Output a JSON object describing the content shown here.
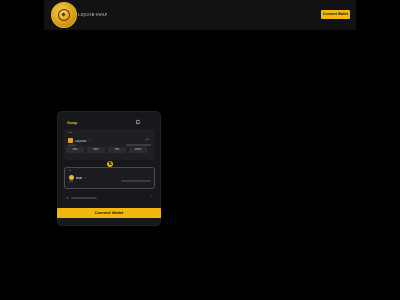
{
  "header": {
    "brand": "LIQUOR-SWAP",
    "connect_label": "Connect Wallet"
  },
  "card": {
    "title": "Swap",
    "from": {
      "label": "From",
      "token": "LIQUOR",
      "token_sub": "LIQUOR",
      "balance_label": "Bal"
    },
    "percentages": [
      "25%",
      "50%",
      "75%",
      "100%"
    ],
    "to": {
      "label": "To",
      "token": "BNB",
      "token_sub": "BNB"
    }
  },
  "connect_button": "Connect Wallet",
  "colors": {
    "accent": "#f0b90b",
    "card_bg": "#17181b",
    "page_bg": "#000000"
  },
  "icons": {
    "logo": "coin-logo",
    "refresh": "refresh-icon",
    "swap": "swap-arrows-icon",
    "chevron": "chevron-down-icon"
  }
}
